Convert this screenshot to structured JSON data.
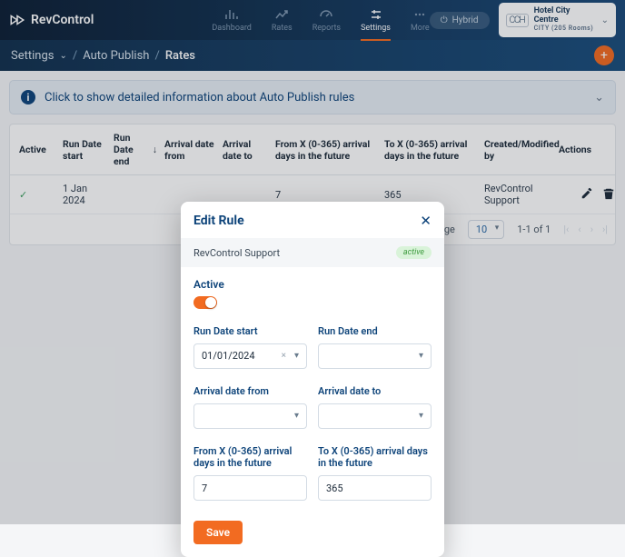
{
  "brand": {
    "name": "RevControl"
  },
  "nav": {
    "items": [
      {
        "label": "Dashboard",
        "icon": "bar-chart"
      },
      {
        "label": "Rates",
        "icon": "trend-up"
      },
      {
        "label": "Reports",
        "icon": "speedometer"
      },
      {
        "label": "Settings",
        "icon": "sliders",
        "active": true
      },
      {
        "label": "More",
        "icon": "dots"
      }
    ],
    "hybrid": {
      "label": "Hybrid"
    },
    "hotel": {
      "name": "Hotel City Centre",
      "sub": "CITY (205 Rooms)",
      "logo": "CCH"
    }
  },
  "breadcrumb": {
    "items": [
      "Settings",
      "Auto Publish",
      "Rates"
    ]
  },
  "banner": {
    "text": "Click to show detailed information about Auto Publish rules"
  },
  "table": {
    "headers": [
      "Active",
      "Run Date start",
      "Run Date end",
      "Arrival date from",
      "Arrival date to",
      "From X (0-365) arrival days in the future",
      "To X (0-365) arrival days in the future",
      "Created/Modified by",
      "Actions"
    ],
    "row": {
      "active": true,
      "run_start": "1 Jan 2024",
      "run_end": "",
      "arr_from": "",
      "arr_to": "",
      "from_x": "7",
      "to_x": "365",
      "by": "RevControl Support"
    },
    "foot": {
      "items_label": "Items per page",
      "per_page": "10",
      "range": "1-1 of 1"
    }
  },
  "modal": {
    "title": "Edit Rule",
    "subtitle": "RevControl Support",
    "badge": "active",
    "active_label": "Active",
    "fields": {
      "run_start": {
        "label": "Run Date start",
        "value": "01/01/2024"
      },
      "run_end": {
        "label": "Run Date end",
        "value": ""
      },
      "arr_from": {
        "label": "Arrival date from",
        "value": ""
      },
      "arr_to": {
        "label": "Arrival date to",
        "value": ""
      },
      "from_x": {
        "label": "From X (0-365) arrival days in the future",
        "value": "7"
      },
      "to_x": {
        "label": "To X (0-365) arrival days in the future",
        "value": "365"
      }
    },
    "save": "Save"
  }
}
